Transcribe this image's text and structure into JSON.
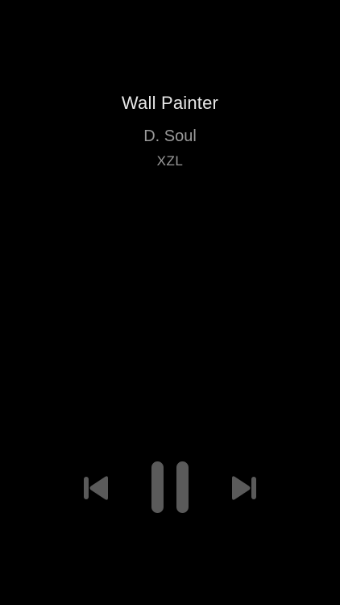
{
  "now_playing": {
    "title": "Wall Painter",
    "artist": "D. Soul",
    "album": "XZL"
  },
  "controls": {
    "previous_icon": "skip-back-icon",
    "pause_icon": "pause-icon",
    "next_icon": "skip-forward-icon",
    "icon_color": "#5a5a5a"
  },
  "colors": {
    "background": "#000000",
    "title": "#e6e6e6",
    "secondary_text": "#9a9a9a"
  }
}
